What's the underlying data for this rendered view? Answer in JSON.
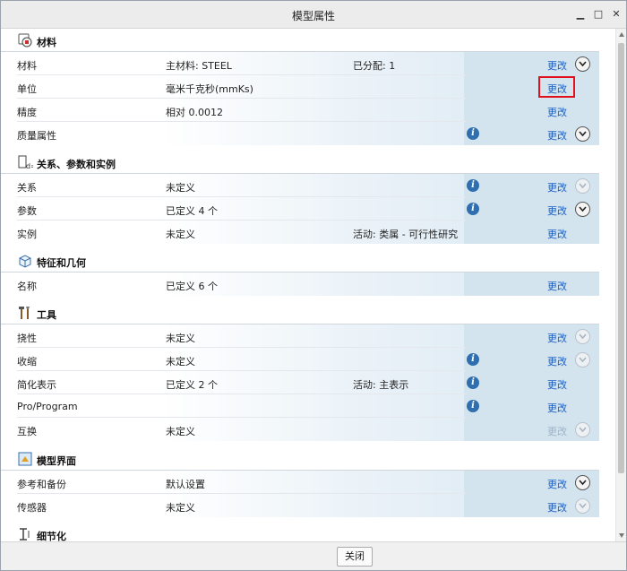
{
  "window": {
    "title": "模型属性",
    "minimize_glyph": "▁",
    "maximize_glyph": "□",
    "close_glyph": "✕"
  },
  "sections": {
    "material": {
      "title": "材料",
      "icon": "material-icon"
    },
    "relations": {
      "title": "关系、参数和实例",
      "icon": "relations-icon"
    },
    "features": {
      "title": "特征和几何",
      "icon": "features-geometry-icon"
    },
    "tools": {
      "title": "工具",
      "icon": "tools-icon"
    },
    "model_interface": {
      "title": "模型界面",
      "icon": "model-interface-icon"
    },
    "detailing": {
      "title": "细节化",
      "icon": "detailing-icon"
    }
  },
  "rows": {
    "material": {
      "label": "材料",
      "value": "主材料: STEEL",
      "extra": "已分配: 1",
      "action": "更改"
    },
    "units": {
      "label": "单位",
      "value": "毫米千克秒(mmKs)",
      "action": "更改"
    },
    "accuracy": {
      "label": "精度",
      "value": "相对 0.0012",
      "action": "更改"
    },
    "mass_props": {
      "label": "质量属性",
      "action": "更改"
    },
    "relations": {
      "label": "关系",
      "value": "未定义",
      "action": "更改"
    },
    "parameters": {
      "label": "参数",
      "value": "已定义 4 个",
      "action": "更改"
    },
    "instances": {
      "label": "实例",
      "value": "未定义",
      "extra": "活动: 类属 - 可行性研究",
      "action": "更改"
    },
    "names": {
      "label": "名称",
      "value": "已定义 6 个",
      "action": "更改"
    },
    "flexibility": {
      "label": "挠性",
      "value": "未定义",
      "action": "更改"
    },
    "shrinkage": {
      "label": "收缩",
      "value": "未定义",
      "action": "更改"
    },
    "simp_rep": {
      "label": "简化表示",
      "value": "已定义 2 个",
      "extra": "活动: 主表示",
      "action": "更改"
    },
    "pro_program": {
      "label": "Pro/Program",
      "action": "更改"
    },
    "interchange": {
      "label": "互换",
      "value": "未定义",
      "action": "更改"
    },
    "ref_backup": {
      "label": "参考和备份",
      "value": "默认设置",
      "action": "更改"
    },
    "sensors": {
      "label": "传感器",
      "value": "未定义",
      "action": "更改"
    }
  },
  "help_glyph": "i",
  "footer": {
    "close_label": "关闭"
  },
  "colors": {
    "link": "#1b5fc1",
    "highlight": "#e0101c",
    "action_column": "#d3e4ef"
  }
}
